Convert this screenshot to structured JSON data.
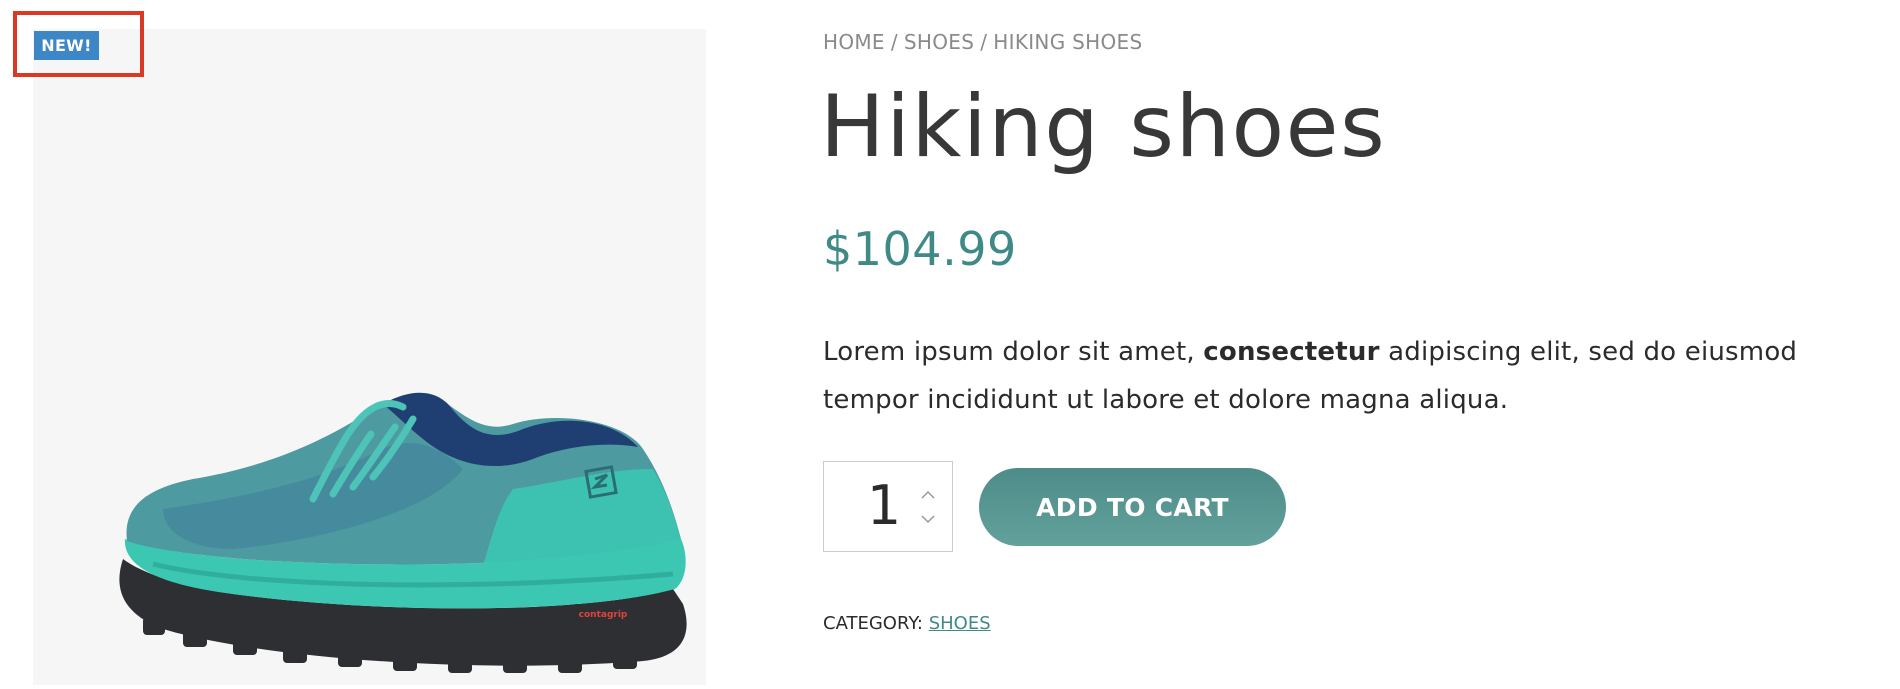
{
  "badge": {
    "label": "NEW!",
    "color": "#3d87c6",
    "highlight_color": "#d83a26"
  },
  "product_image": {
    "alt": "Teal hiking shoe",
    "sole_text": "contagrip",
    "colors": {
      "background": "#f6f6f6",
      "upper": "#4e9aa1",
      "accent": "#3cc7b3",
      "navy": "#1f3f73",
      "sole": "#2d2f33"
    }
  },
  "breadcrumb": {
    "items": [
      "HOME",
      "SHOES",
      "HIKING SHOES"
    ],
    "separator": "/"
  },
  "product": {
    "title": "Hiking shoes",
    "price": "$104.99",
    "price_color": "#3f8a87",
    "description": {
      "part1": "Lorem ipsum dolor sit amet, ",
      "bold": "consectetur",
      "part2": " adipiscing elit, sed do eiusmod tempor incididunt ut labore et dolore magna aliqua."
    }
  },
  "quantity": {
    "value": "1",
    "up_icon": "chevron-up-icon",
    "down_icon": "chevron-down-icon"
  },
  "cart": {
    "button_label": "ADD TO CART",
    "button_color": "#4d8c89"
  },
  "category": {
    "label": "CATEGORY: ",
    "value": "SHOES"
  }
}
